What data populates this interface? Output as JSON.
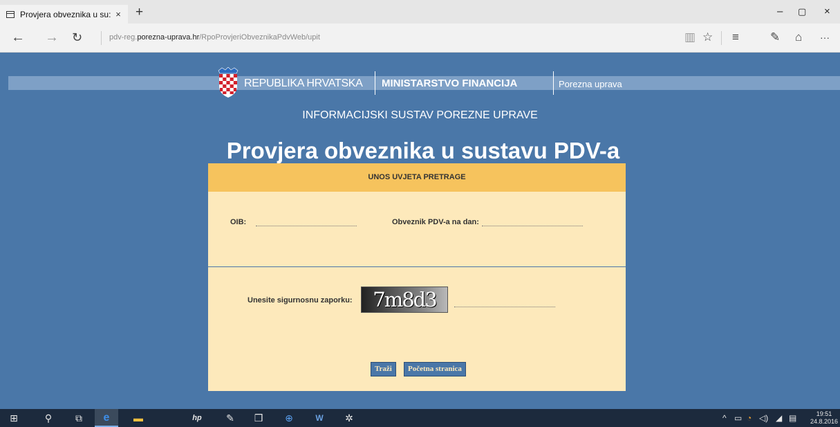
{
  "browser": {
    "tab_title": "Provjera obveznika u su:",
    "tab_close": "×",
    "new_tab": "+",
    "url_prefix": "pdv-reg.",
    "url_domain": "porezna-uprava.hr",
    "url_path": "/RpoProvjeriObveznikaPdvWeb/upit",
    "window_controls": {
      "minimize": "–",
      "maximize": "▢",
      "close": "×"
    },
    "nav": {
      "back": "←",
      "forward": "→",
      "refresh": "↻"
    },
    "tools": {
      "reading": "▥",
      "favorite": "☆",
      "hub": "≡",
      "notes": "✎",
      "share": "⌂",
      "more": "···"
    }
  },
  "header": {
    "republic": "REPUBLIKA HRVATSKA",
    "ministry": "MINISTARSTVO FINANCIJA",
    "agency": "Porezna uprava",
    "system": "INFORMACIJSKI SUSTAV POREZNE UPRAVE",
    "title": "Provjera obveznika u sustavu PDV-a"
  },
  "form": {
    "heading": "UNOS UVJETA PRETRAGE",
    "oib_label": "OIB:",
    "oib_value": "",
    "date_label": "Obveznik PDV-a na dan:",
    "date_value": "",
    "captcha_label": "Unesite sigurnosnu zaporku:",
    "captcha_text": "7m8d3",
    "captcha_value": "",
    "search_button": "Traži",
    "home_button": "Početna stranica"
  },
  "taskbar": {
    "icons": {
      "start": "⊞",
      "search": "⚲",
      "task_view": "⧉",
      "edge": "e",
      "explorer": "▬",
      "hp": "hp",
      "paint": "✎",
      "box": "❒",
      "globe": "⊕",
      "word": "W",
      "settings": "✲"
    },
    "tray": {
      "chevron": "^",
      "battery": "▭",
      "network": "◔",
      "volume": "◁)",
      "wifi": "◢",
      "notifications": "▤"
    },
    "time": "19:51",
    "date": "24.8.2016"
  },
  "colors": {
    "page_bg": "#4a77a8",
    "form_bg": "#fde9bb",
    "form_header": "#f6c35d"
  }
}
